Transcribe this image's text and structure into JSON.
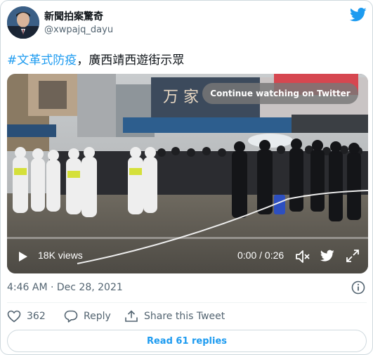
{
  "header": {
    "display_name": "新聞拍案驚奇",
    "handle": "@xwpajq_dayu"
  },
  "tweet": {
    "hashtag": "#文革式防疫",
    "text": "，廣西靖西遊街示眾"
  },
  "video": {
    "continue_label": "Continue watching on Twitter",
    "views": "18K views",
    "time": "0:00 / 0:26",
    "sign_text": "万 家"
  },
  "meta": {
    "timestamp": "4:46 AM · Dec 28, 2021"
  },
  "actions": {
    "likes": "362",
    "reply_label": "Reply",
    "share_label": "Share this Tweet"
  },
  "footer": {
    "read_replies": "Read 61 replies"
  },
  "colors": {
    "accent": "#1d9bf0",
    "text_secondary": "#536471",
    "border": "#cfd9de"
  },
  "icons": [
    "avatar",
    "twitter-bird-icon",
    "play-icon",
    "volume-icon",
    "expand-icon",
    "info-icon",
    "heart-icon",
    "reply-icon",
    "share-icon"
  ]
}
